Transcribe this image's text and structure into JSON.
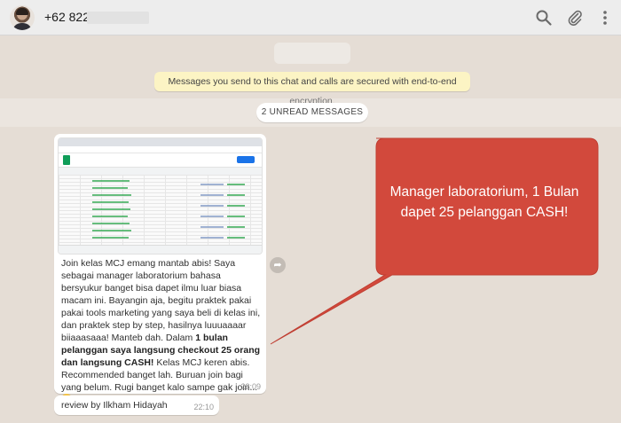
{
  "header": {
    "contact_number": "+62 822-",
    "icons": [
      "search-icon",
      "attach-icon",
      "menu-icon"
    ]
  },
  "chat": {
    "encryption_notice": "Messages you send to this chat and calls are secured with end-to-end encryption.",
    "unread_label": "2 UNREAD MESSAGES",
    "messages": [
      {
        "text_part1": "Join kelas MCJ emang mantab abis! Saya sebagai manager laboratorium bahasa bersyukur banget bisa dapet ilmu luar biasa macam ini. Bayangin aja, begitu praktek pakai pakai tools marketing yang saya beli di kelas ini, dan praktek step by step, hasilnya luuuaaaar biiaaasaaa! Manteb dah. Dalam ",
        "text_bold": "1 bulan pelanggan saya langsung checkout 25 orang dan langsung CASH!",
        "text_part2": " Kelas MCJ keren abis. Recommended banget lah. Buruan join bagi yang belum. Rugi banget kalo sampe gak join...",
        "time": "22:09"
      },
      {
        "text": "review by Ilkham Hidayah",
        "time": "22:10"
      }
    ]
  },
  "callout": {
    "text": "Manager laboratorium, 1 Bulan dapet 25 pelanggan CASH!",
    "color": "#d2493c"
  }
}
